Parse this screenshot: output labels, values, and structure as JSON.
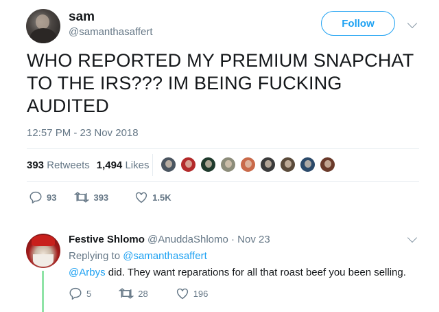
{
  "tweet": {
    "display_name": "sam",
    "handle": "@samanthasaffert",
    "follow_label": "Follow",
    "text": "WHO REPORTED MY PREMIUM SNAPCHAT TO THE IRS??? IM BEING FUCKING AUDITED",
    "timestamp": "12:57 PM - 23 Nov 2018",
    "retweets_count": "393",
    "retweets_label": "Retweets",
    "likes_count": "1,494",
    "likes_label": "Likes",
    "reply_count": "93",
    "retweet_count": "393",
    "like_count": "1.5K"
  },
  "likers": [
    "#4a5560",
    "#b32a2a",
    "#1f3a2c",
    "#8c8c7a",
    "#c96a4a",
    "#3b3b3b",
    "#5a4a3a",
    "#2c4a6a",
    "#6a3a2a"
  ],
  "reply": {
    "display_name": "Festive Shlomo",
    "handle": "@AnuddaShlomo",
    "date": "· Nov 23",
    "replying_prefix": "Replying to",
    "replying_to": "@samanthasaffert",
    "mention": "@Arbys",
    "text": " did. They want reparations for all that roast beef you been selling.",
    "reply_count": "5",
    "retweet_count": "28",
    "like_count": "196"
  },
  "colors": {
    "accent": "#1da1f2",
    "muted": "#657786",
    "thread_line": "#8fe3a6"
  },
  "icons": [
    "chevron-down-icon",
    "reply-icon",
    "retweet-icon",
    "like-icon"
  ]
}
